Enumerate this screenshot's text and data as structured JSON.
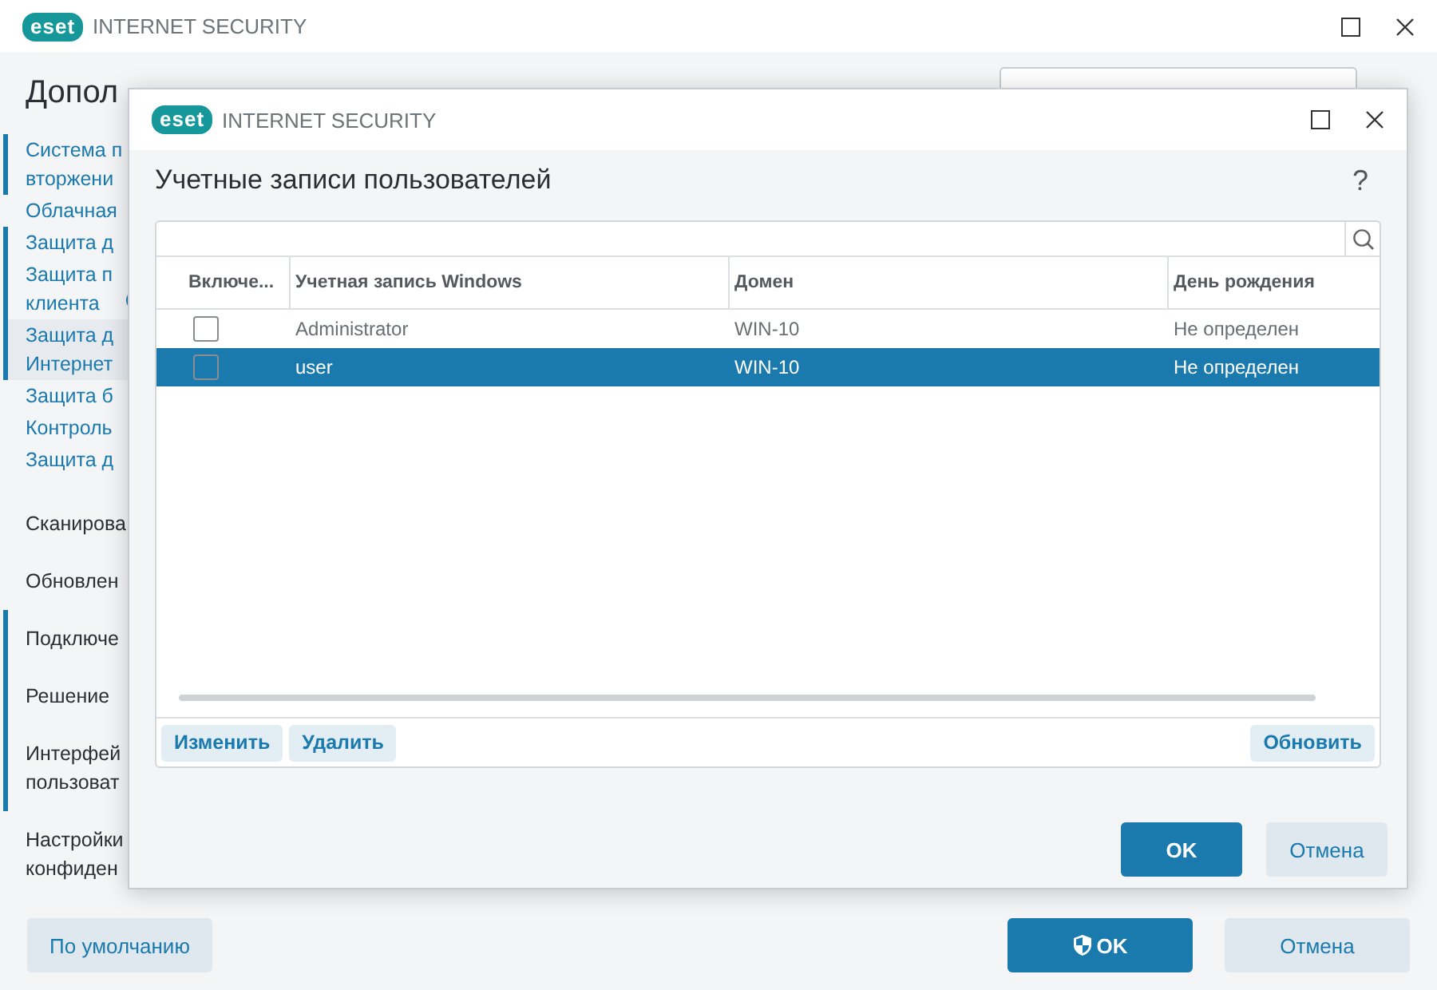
{
  "main_window": {
    "logo": "eset",
    "product": "INTERNET SECURITY",
    "page_title": "Допол",
    "sidebar": [
      {
        "lines": [
          "Система п",
          "вторжени"
        ],
        "marked": true,
        "selected": false,
        "badge": false,
        "kind": "sub"
      },
      {
        "lines": [
          "Облачная"
        ],
        "marked": false,
        "selected": false,
        "badge": false,
        "kind": "sub"
      },
      {
        "lines": [
          "Защита д"
        ],
        "marked": true,
        "selected": false,
        "badge": false,
        "kind": "sub"
      },
      {
        "lines": [
          "Защита п",
          "клиента"
        ],
        "marked": true,
        "selected": false,
        "badge": true,
        "kind": "sub"
      },
      {
        "lines": [
          "Защита д",
          "Интернет"
        ],
        "marked": true,
        "selected": true,
        "badge": false,
        "kind": "sub"
      },
      {
        "lines": [
          "Защита б"
        ],
        "marked": false,
        "selected": false,
        "badge": false,
        "kind": "sub"
      },
      {
        "lines": [
          "Контроль"
        ],
        "marked": false,
        "selected": false,
        "badge": false,
        "kind": "sub"
      },
      {
        "lines": [
          "Защита д"
        ],
        "marked": false,
        "selected": false,
        "badge": false,
        "kind": "sub"
      },
      {
        "lines": [
          "Сканирова"
        ],
        "marked": false,
        "selected": false,
        "badge": false,
        "kind": "section"
      },
      {
        "lines": [
          "Обновлен"
        ],
        "marked": false,
        "selected": false,
        "badge": false,
        "kind": "section"
      },
      {
        "lines": [
          "Подключе"
        ],
        "marked": true,
        "selected": false,
        "badge": false,
        "kind": "section"
      },
      {
        "lines": [
          "Решение"
        ],
        "marked": true,
        "selected": false,
        "badge": false,
        "kind": "section"
      },
      {
        "lines": [
          "Интерфей",
          "пользоват"
        ],
        "marked": true,
        "selected": false,
        "badge": false,
        "kind": "section"
      },
      {
        "lines": [
          "Настройки",
          "конфиден"
        ],
        "marked": false,
        "selected": false,
        "badge": false,
        "kind": "section"
      }
    ],
    "buttons": [
      {
        "label": "По умолчанию",
        "kind": "secondary",
        "shield": false
      },
      {
        "label": "OK",
        "kind": "primary",
        "shield": true
      },
      {
        "label": "Отмена",
        "kind": "secondary",
        "shield": false
      }
    ]
  },
  "dialog": {
    "logo": "eset",
    "product": "INTERNET SECURITY",
    "title": "Учетные записи пользователей",
    "help": "?",
    "table": {
      "columns": [
        "Включе...",
        "Учетная запись Windows",
        "Домен",
        "День рождения"
      ],
      "rows": [
        {
          "checked": false,
          "selected": false,
          "account": "Administrator",
          "domain": "WIN-10",
          "birthday": "Не определен"
        },
        {
          "checked": false,
          "selected": true,
          "account": "user",
          "domain": "WIN-10",
          "birthday": "Не определен"
        }
      ]
    },
    "table_buttons": [
      "Изменить",
      "Удалить",
      "Обновить"
    ],
    "buttons": [
      {
        "label": "OK",
        "kind": "primary"
      },
      {
        "label": "Отмена",
        "kind": "secondary"
      }
    ]
  }
}
